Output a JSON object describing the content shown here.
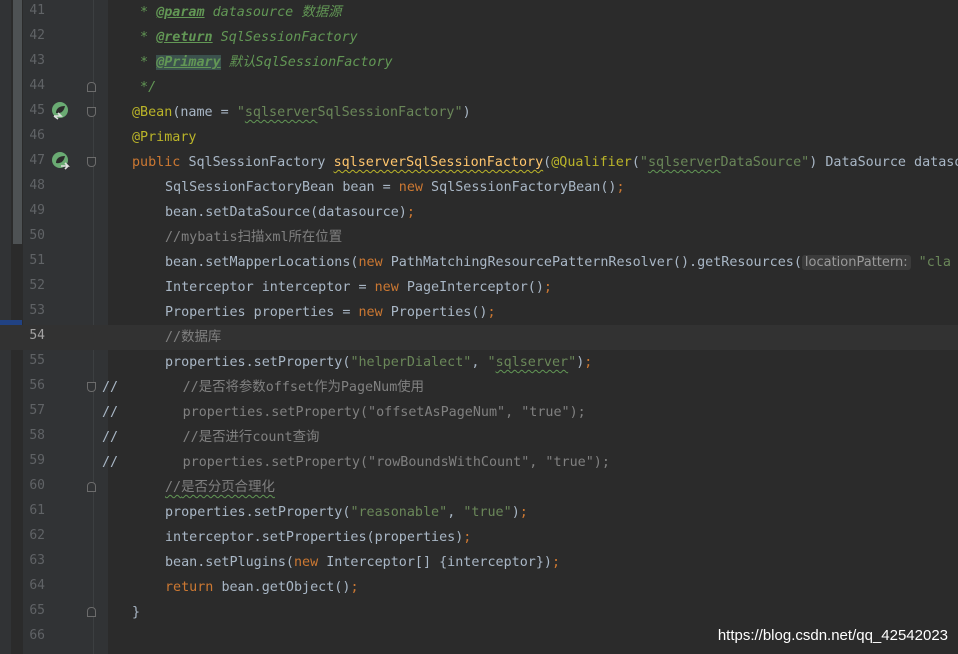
{
  "editor": {
    "current_line": "54",
    "lines": [
      {
        "n": "41",
        "t1": " * ",
        "t2": "@param",
        "t3": " datasource ",
        "t4": "数据源"
      },
      {
        "n": "42",
        "t1": " * ",
        "t2": "@return",
        "t3": " SqlSessionFactory"
      },
      {
        "n": "43",
        "t1": " * ",
        "t2": "@Primary",
        "t3": " ",
        "t4": "默认",
        "t5": "SqlSessionFactory"
      },
      {
        "n": "44",
        "t1": " */"
      },
      {
        "n": "45",
        "t1": "@Bean",
        "t2": "(name = ",
        "t3": "\"",
        "t4": "sqlserver",
        "t5": "SqlSessionFactory\"",
        "t6": ")"
      },
      {
        "n": "46",
        "t1": "@Primary"
      },
      {
        "n": "47",
        "t1": "public ",
        "t2": "SqlSessionFactory ",
        "t3": "sqlserverSqlSessionFactory",
        "t4": "(",
        "t5": "@Qualifier",
        "t6": "(",
        "t7": "\"",
        "t8": "sqlserver",
        "t9": "DataSource\"",
        "t10": ") DataSource datasou"
      },
      {
        "n": "48",
        "t1": "SqlSessionFactoryBean bean = ",
        "t2": "new ",
        "t3": "SqlSessionFactoryBean()",
        "t4": ";"
      },
      {
        "n": "49",
        "t1": "bean.setDataSource(datasource)",
        "t2": ";"
      },
      {
        "n": "50",
        "t1": "//mybatis",
        "t2": "扫描",
        "t3": "xml",
        "t4": "所在位置"
      },
      {
        "n": "51",
        "t1": "bean.setMapperLocations(",
        "t2": "new ",
        "t3": "PathMatchingResourcePatternResolver().getResources(",
        "t4": "locationPattern:",
        "t5": " \"cla"
      },
      {
        "n": "52",
        "t1": "Interceptor interceptor = ",
        "t2": "new ",
        "t3": "PageInterceptor()",
        "t4": ";"
      },
      {
        "n": "53",
        "t1": "Properties properties = ",
        "t2": "new ",
        "t3": "Properties()",
        "t4": ";"
      },
      {
        "n": "54",
        "t1": "//",
        "t2": "数据库"
      },
      {
        "n": "55",
        "t1": "properties.setProperty(",
        "t2": "\"helperDialect\"",
        "t3": ", ",
        "t4": "\"",
        "t5": "sqlserver",
        "t6": "\"",
        "t7": ")",
        "t8": ";"
      },
      {
        "n": "56",
        "t1": "//",
        "t2": "        //",
        "t3": "是否将参数",
        "t4": "offset",
        "t5": "作为",
        "t6": "PageNum",
        "t7": "使用"
      },
      {
        "n": "57",
        "t1": "//",
        "t2": "        properties.setProperty(\"offsetAsPageNum\", \"true\");"
      },
      {
        "n": "58",
        "t1": "//",
        "t2": "        //",
        "t3": "是否进行",
        "t4": "count",
        "t5": "查询"
      },
      {
        "n": "59",
        "t1": "//",
        "t2": "        properties.setProperty(\"rowBoundsWithCount\", \"true\");"
      },
      {
        "n": "60",
        "t1": "//",
        "t2": "是否分页合理化"
      },
      {
        "n": "61",
        "t1": "properties.setProperty(",
        "t2": "\"reasonable\"",
        "t3": ", ",
        "t4": "\"true\"",
        "t5": ")",
        "t6": ";"
      },
      {
        "n": "62",
        "t1": "interceptor.setProperties(properties)",
        "t2": ";"
      },
      {
        "n": "63",
        "t1": "bean.setPlugins(",
        "t2": "new ",
        "t3": "Interceptor[] {interceptor})",
        "t4": ";"
      },
      {
        "n": "64",
        "t1": "return ",
        "t2": "bean.getObject()",
        "t3": ";"
      },
      {
        "n": "65",
        "t1": "}"
      },
      {
        "n": "66"
      }
    ]
  },
  "icons": {
    "gutter_bean_45": "spring-bean-navigate-back-icon",
    "gutter_bean_47": "spring-bean-navigate-forward-icon",
    "fold": "fold-marker-icon"
  },
  "colors": {
    "background": "#2b2b2b",
    "gutter": "#313335",
    "keyword": "#cc7832",
    "string": "#6a8759",
    "annotation": "#bbb529",
    "comment": "#808080",
    "doc_comment": "#629755",
    "method_decl": "#ffc66d",
    "default_text": "#a9b7c6"
  },
  "watermark": "https://blog.csdn.net/qq_42542023"
}
